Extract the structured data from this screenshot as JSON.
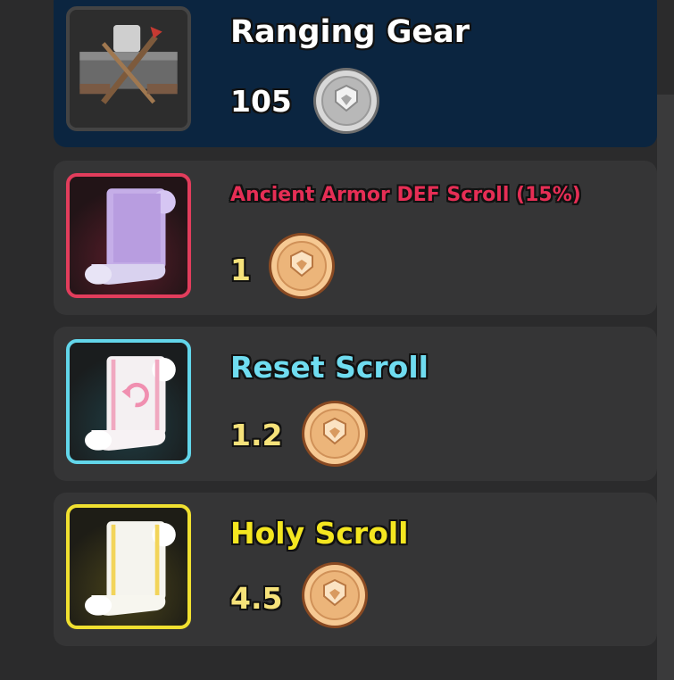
{
  "items": [
    {
      "name": "Ranging Gear",
      "price": "105",
      "currency_icon": "silver-coin-icon",
      "item_icon": "ranging-gear-icon",
      "rarity_color": "#444444",
      "name_color": "#ffffff",
      "price_color": "#ffffff",
      "selected": true
    },
    {
      "name": "Ancient Armor DEF Scroll (15%)",
      "price": "1",
      "currency_icon": "bronze-coin-icon",
      "item_icon": "purple-scroll-icon",
      "rarity_color": "#e23d5c",
      "name_color": "#e62e55",
      "price_color": "#f6e27a",
      "selected": false
    },
    {
      "name": "Reset Scroll",
      "price": "1.2",
      "currency_icon": "bronze-coin-icon",
      "item_icon": "reset-scroll-icon",
      "rarity_color": "#62d6ea",
      "name_color": "#6fdcf0",
      "price_color": "#f6e27a",
      "selected": false
    },
    {
      "name": "Holy Scroll",
      "price": "4.5",
      "currency_icon": "bronze-coin-icon",
      "item_icon": "holy-scroll-icon",
      "rarity_color": "#f0e030",
      "name_color": "#f4e620",
      "price_color": "#f6e27a",
      "selected": false
    }
  ]
}
